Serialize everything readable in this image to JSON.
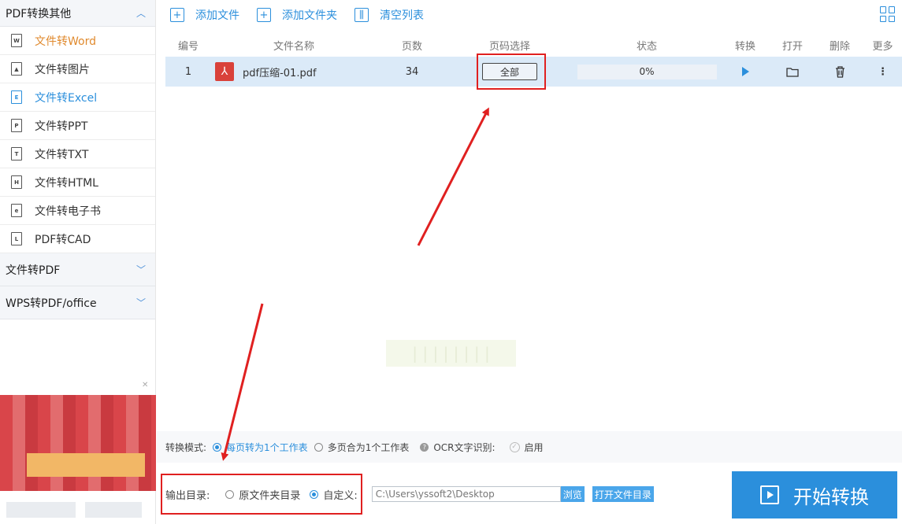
{
  "sidebar": {
    "section1": "PDF转换其他",
    "items": [
      {
        "label": "文件转Word",
        "icon": "W"
      },
      {
        "label": "文件转图片",
        "icon": "▲"
      },
      {
        "label": "文件转Excel",
        "icon": "E"
      },
      {
        "label": "文件转PPT",
        "icon": "P"
      },
      {
        "label": "文件转TXT",
        "icon": "T"
      },
      {
        "label": "文件转HTML",
        "icon": "H"
      },
      {
        "label": "文件转电子书",
        "icon": "e"
      },
      {
        "label": "PDF转CAD",
        "icon": "L"
      }
    ],
    "section2": "文件转PDF",
    "section3": "WPS转PDF/office"
  },
  "toolbar": {
    "add_file": "添加文件",
    "add_folder": "添加文件夹",
    "clear_list": "清空列表"
  },
  "table": {
    "headers": [
      "编号",
      "文件名称",
      "页数",
      "页码选择",
      "状态",
      "转换",
      "打开",
      "删除",
      "更多"
    ],
    "rows": [
      {
        "index": "1",
        "name": "pdf压缩-01.pdf",
        "pages": "34",
        "page_select": "全部",
        "status": "0%"
      }
    ]
  },
  "mode": {
    "label": "转换模式:",
    "option1": "每页转为1个工作表",
    "option2": "多页合为1个工作表",
    "ocr_label": "OCR文字识别:",
    "ocr_value": "启用"
  },
  "output": {
    "label": "输出目录:",
    "option1": "原文件夹目录",
    "option2": "自定义:",
    "path": "C:\\Users\\yssoft2\\Desktop",
    "browse": "浏览",
    "open_dir": "打开文件目录"
  },
  "start_button": "开始转换",
  "colors": {
    "accent": "#2b8fdc",
    "annotation": "#e02020",
    "row_selected": "#dbeaf8"
  }
}
